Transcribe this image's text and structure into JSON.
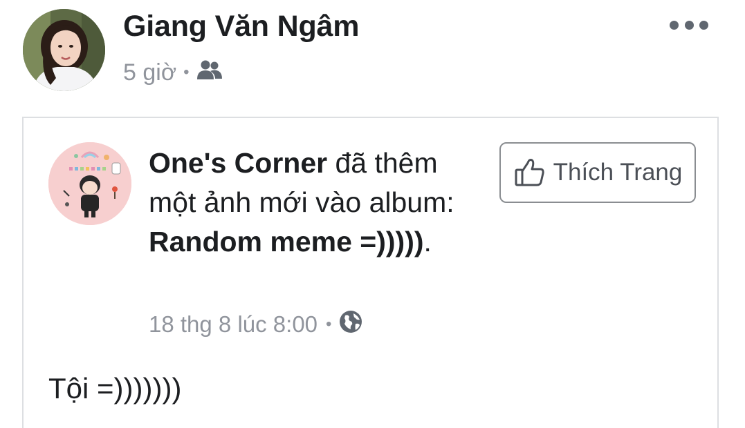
{
  "post": {
    "author": "Giang Văn Ngâm",
    "time": "5 giờ",
    "separator": "•",
    "audience_icon": "friends-icon",
    "more_icon": "more-options-icon"
  },
  "shared": {
    "page_name": "One's Corner",
    "action_text_1": " đã thêm một ảnh mới vào album: ",
    "album_name": "Random meme =)))))",
    "action_text_end": ".",
    "like_button_label": "Thích Trang",
    "like_icon": "thumbs-up-icon",
    "timestamp": "18 thg 8 lúc 8:00",
    "separator": "•",
    "privacy_icon": "globe-icon",
    "caption": "Tội =)))))))"
  },
  "colors": {
    "text_primary": "#1c1e21",
    "text_secondary": "#90949c",
    "card_border": "#dddfe2",
    "button_border": "#8a8d91"
  }
}
